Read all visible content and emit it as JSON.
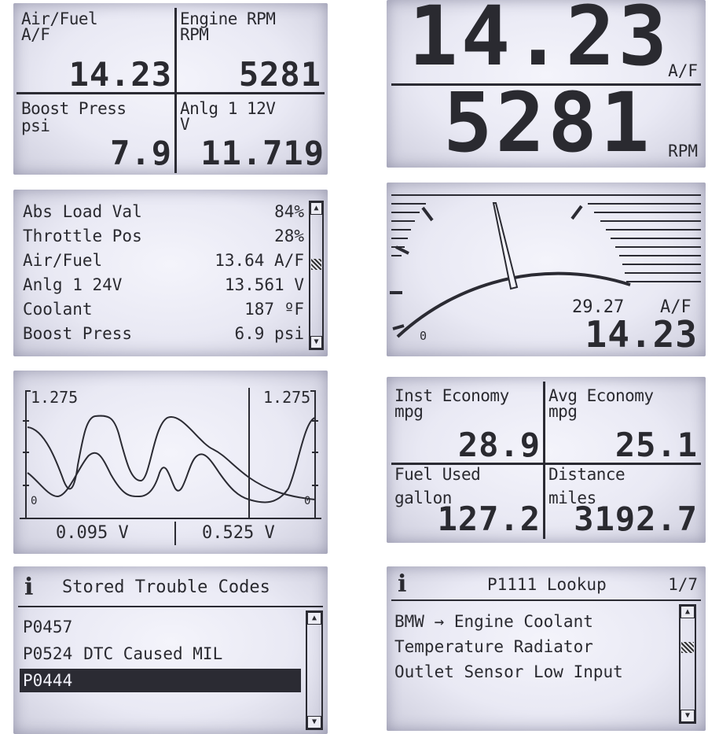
{
  "screen1": {
    "cells": [
      {
        "label": "Air/Fuel",
        "unit": "A/F",
        "value": "14.23"
      },
      {
        "label": "Engine RPM",
        "unit": "RPM",
        "value": "5281"
      },
      {
        "label": "Boost Press",
        "unit": "psi",
        "value": "7.9"
      },
      {
        "label": "Anlg 1 12V",
        "unit": "V",
        "value": "11.719"
      }
    ]
  },
  "screen2": {
    "top_value": "14.23",
    "top_unit": "A/F",
    "bottom_value": "5281",
    "bottom_unit": "RPM"
  },
  "screen3": {
    "rows": [
      {
        "label": "Abs Load Val",
        "value": "84%"
      },
      {
        "label": "Throttle Pos",
        "value": "28%"
      },
      {
        "label": "Air/Fuel",
        "value": "13.64 A/F"
      },
      {
        "label": "Anlg 1 24V",
        "value": "13.561 V"
      },
      {
        "label": "Coolant",
        "value": "187 ºF"
      },
      {
        "label": "Boost Press",
        "value": "6.9 psi"
      }
    ]
  },
  "screen4": {
    "peak_value": "29.27",
    "unit": "A/F",
    "value": "14.23",
    "min_label": "0"
  },
  "screen5": {
    "left_max": "1.275",
    "right_max": "1.275",
    "left_min": "0",
    "right_min": "0",
    "left_reading": "0.095 V",
    "right_reading": "0.525 V"
  },
  "screen6": {
    "cells": [
      {
        "label": "Inst Economy",
        "unit": "mpg",
        "value": "28.9"
      },
      {
        "label": "Avg Economy",
        "unit": "mpg",
        "value": "25.1"
      },
      {
        "label": "Fuel Used",
        "unit": "gallon",
        "value": "127.2"
      },
      {
        "label": "Distance",
        "unit": "miles",
        "value": "3192.7"
      }
    ]
  },
  "screen7": {
    "info_icon": "i",
    "title": "Stored Trouble Codes",
    "codes": [
      {
        "code": "P0457",
        "desc": ""
      },
      {
        "code": "P0524",
        "desc": "DTC Caused MIL"
      },
      {
        "code": "P0444",
        "desc": ""
      }
    ],
    "selected_index": 2
  },
  "screen8": {
    "info_icon": "i",
    "title": "P1111 Lookup",
    "page": "1/7",
    "lines": [
      "BMW → Engine Coolant",
      "Temperature Radiator",
      "Outlet Sensor Low Input"
    ]
  },
  "icons": {
    "scroll_up": "▲",
    "scroll_down": "▼"
  },
  "colors": {
    "ink": "#2b2b33",
    "lcd_background": "#e9e9f4",
    "selection": "#2b2b33"
  }
}
